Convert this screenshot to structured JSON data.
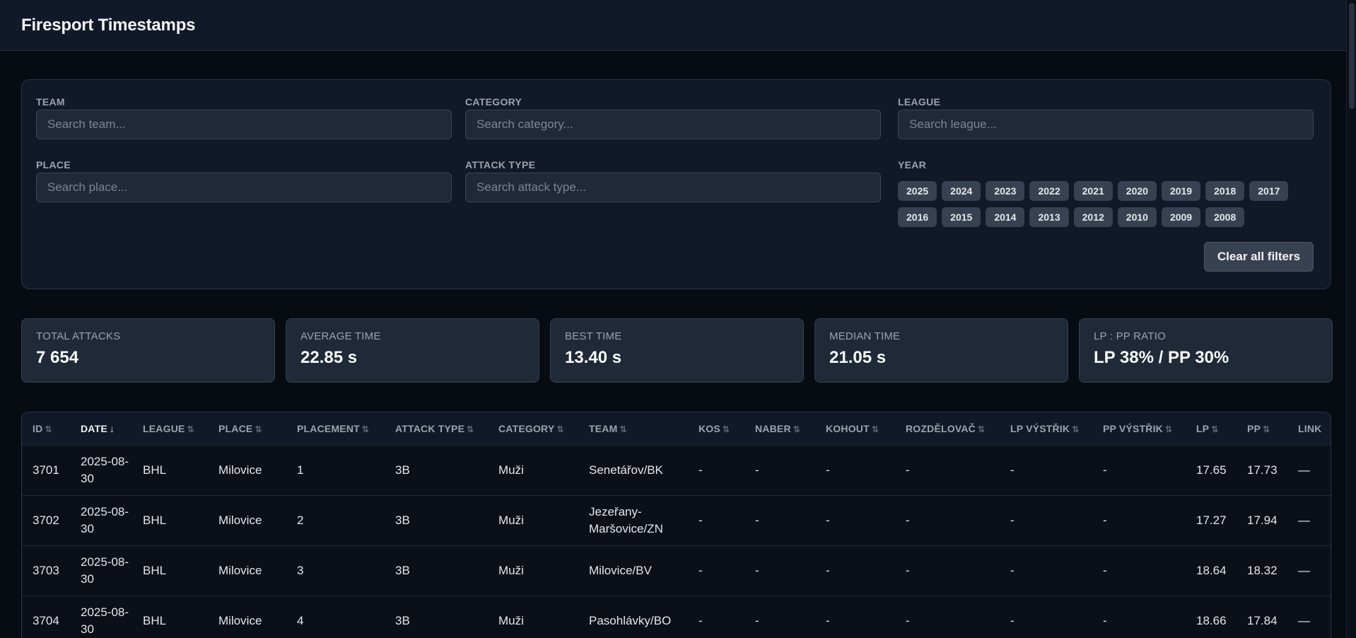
{
  "app": {
    "title": "Firesport Timestamps"
  },
  "filters": {
    "team": {
      "label": "Team",
      "placeholder": "Search team..."
    },
    "category": {
      "label": "Category",
      "placeholder": "Search category..."
    },
    "league": {
      "label": "League",
      "placeholder": "Search league..."
    },
    "place": {
      "label": "Place",
      "placeholder": "Search place..."
    },
    "attack_type": {
      "label": "Attack Type",
      "placeholder": "Search attack type..."
    },
    "year": {
      "label": "Year",
      "row1": [
        "2025",
        "2024",
        "2023",
        "2022",
        "2021",
        "2020",
        "2019",
        "2018",
        "2017"
      ],
      "row2": [
        "2016",
        "2015",
        "2014",
        "2013",
        "2012",
        "2010",
        "2009",
        "2008"
      ]
    },
    "clear_label": "Clear all filters"
  },
  "stats": [
    {
      "label": "Total Attacks",
      "value": "7 654"
    },
    {
      "label": "Average Time",
      "value": "22.85 s"
    },
    {
      "label": "Best Time",
      "value": "13.40 s"
    },
    {
      "label": "Median Time",
      "value": "21.05 s"
    },
    {
      "label": "LP : PP Ratio",
      "value": "LP 38% / PP 30%"
    }
  ],
  "table": {
    "columns": [
      {
        "label": "ID",
        "sort": "⇅"
      },
      {
        "label": "Date",
        "sort": "↓",
        "active": true
      },
      {
        "label": "League",
        "sort": "⇅"
      },
      {
        "label": "Place",
        "sort": "⇅"
      },
      {
        "label": "Placement",
        "sort": "⇅"
      },
      {
        "label": "Attack Type",
        "sort": "⇅"
      },
      {
        "label": "Category",
        "sort": "⇅"
      },
      {
        "label": "Team",
        "sort": "⇅"
      },
      {
        "label": "Kos",
        "sort": "⇅"
      },
      {
        "label": "Naber",
        "sort": "⇅"
      },
      {
        "label": "Kohout",
        "sort": "⇅"
      },
      {
        "label": "Rozdělovač",
        "sort": "⇅"
      },
      {
        "label": "LP Výstřik",
        "sort": "⇅"
      },
      {
        "label": "PP Výstřik",
        "sort": "⇅"
      },
      {
        "label": "LP",
        "sort": "⇅"
      },
      {
        "label": "PP",
        "sort": "⇅"
      },
      {
        "label": "Link",
        "sort": ""
      }
    ],
    "rows": [
      [
        "3701",
        "2025-08-30",
        "BHL",
        "Milovice",
        "1",
        "3B",
        "Muži",
        "Senetářov/BK",
        "-",
        "-",
        "-",
        "-",
        "-",
        "-",
        "17.65",
        "17.73",
        "—"
      ],
      [
        "3702",
        "2025-08-30",
        "BHL",
        "Milovice",
        "2",
        "3B",
        "Muži",
        "Jezeřany-Maršovice/ZN",
        "-",
        "-",
        "-",
        "-",
        "-",
        "-",
        "17.27",
        "17.94",
        "—"
      ],
      [
        "3703",
        "2025-08-30",
        "BHL",
        "Milovice",
        "3",
        "3B",
        "Muži",
        "Milovice/BV",
        "-",
        "-",
        "-",
        "-",
        "-",
        "-",
        "18.64",
        "18.32",
        "—"
      ],
      [
        "3704",
        "2025-08-30",
        "BHL",
        "Milovice",
        "4",
        "3B",
        "Muži",
        "Pasohlávky/BO",
        "-",
        "-",
        "-",
        "-",
        "-",
        "-",
        "18.66",
        "17.84",
        "—"
      ]
    ]
  }
}
